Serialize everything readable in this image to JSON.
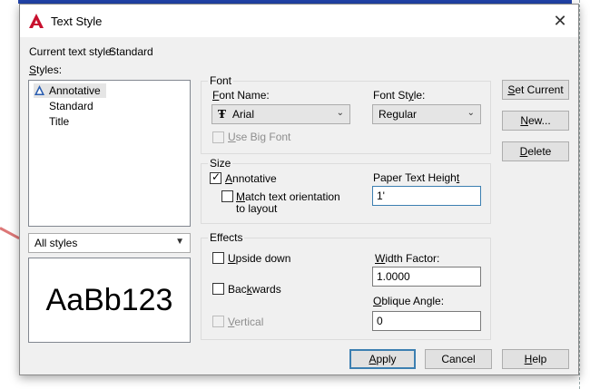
{
  "window": {
    "title": "Text Style",
    "close_glyph": "✕"
  },
  "current_style": {
    "label": "Current text style:",
    "value": "Standard"
  },
  "styles": {
    "label": "Styles:",
    "items": [
      {
        "label": "Annotative",
        "icon": "annotative-icon"
      },
      {
        "label": "Standard"
      },
      {
        "label": "Title"
      }
    ],
    "filter": "All styles"
  },
  "preview": {
    "text": "AaBb123"
  },
  "font": {
    "group_label": "Font",
    "font_name_label": "Font Name:",
    "font_name_value": "Arial",
    "font_style_label": "Font Style:",
    "font_style_value": "Regular",
    "big_font_label": "Use Big Font"
  },
  "size": {
    "group_label": "Size",
    "annotative_label": "Annotative",
    "match_line1": "Match text orientation",
    "match_line2": "to layout",
    "paper_height_label": "Paper Text Height",
    "paper_height_value": "1'"
  },
  "effects": {
    "group_label": "Effects",
    "upside_down_label": "Upside down",
    "backwards_label": "Backwards",
    "vertical_label": "Vertical",
    "width_factor_label": "Width Factor:",
    "width_factor_value": "1.0000",
    "oblique_label": "Oblique Angle:",
    "oblique_value": "0"
  },
  "buttons": {
    "set_current": "Set Current",
    "new": "New...",
    "delete": "Delete",
    "apply": "Apply",
    "cancel": "Cancel",
    "help": "Help"
  },
  "colors": {
    "accent": "#3c7fb1",
    "autocad_red": "#c8102e"
  }
}
